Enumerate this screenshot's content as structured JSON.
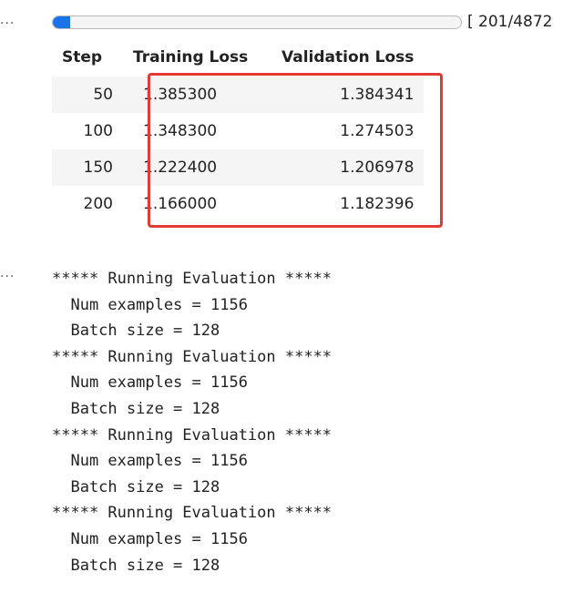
{
  "cell_prompts": [
    "...",
    "..."
  ],
  "progress": {
    "fraction": 0.0413,
    "text": "[ 201/4872 "
  },
  "table": {
    "headers": [
      "Step",
      "Training Loss",
      "Validation Loss"
    ],
    "rows": [
      [
        "50",
        "1.385300",
        "1.384341"
      ],
      [
        "100",
        "1.348300",
        "1.274503"
      ],
      [
        "150",
        "1.222400",
        "1.206978"
      ],
      [
        "200",
        "1.166000",
        "1.182396"
      ]
    ]
  },
  "highlight_color": "#e53935",
  "log_lines": [
    "***** Running Evaluation *****",
    "  Num examples = 1156",
    "  Batch size = 128",
    "***** Running Evaluation *****",
    "  Num examples = 1156",
    "  Batch size = 128",
    "***** Running Evaluation *****",
    "  Num examples = 1156",
    "  Batch size = 128",
    "***** Running Evaluation *****",
    "  Num examples = 1156",
    "  Batch size = 128"
  ]
}
